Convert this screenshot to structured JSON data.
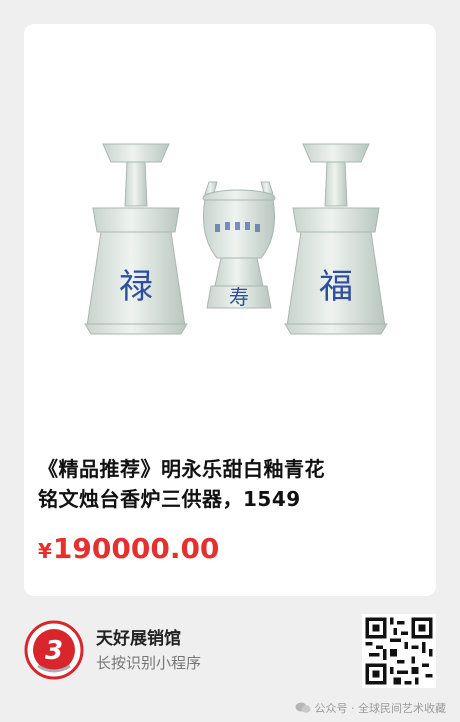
{
  "product": {
    "title_line1": "《精品推荐》明永乐甜白釉青花",
    "title_line2": "铭文烛台香炉三供器，1549",
    "price_currency": "¥",
    "price_value": "190000.00",
    "image_glyphs": [
      "禄",
      "福",
      "寿"
    ]
  },
  "shop": {
    "name": "天好展销馆",
    "hint": "长按识别小程序",
    "logo_glyph": "3"
  },
  "watermark": {
    "text": "公众号 · 全球民间艺术收藏"
  },
  "colors": {
    "price": "#e53030",
    "porcelain": "#e2eae6",
    "blue_glaze": "#2f4f9c",
    "logo_red": "#d9262c"
  }
}
